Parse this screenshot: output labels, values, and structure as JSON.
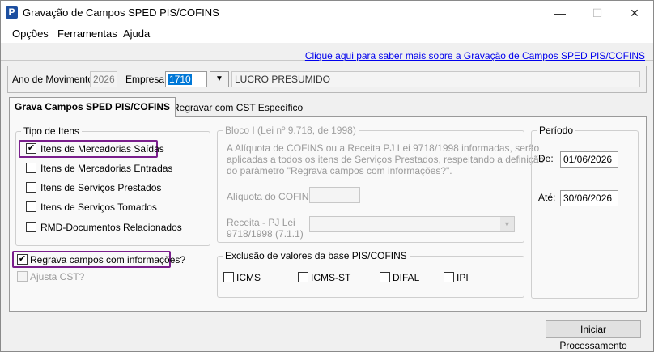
{
  "window": {
    "app_icon": "P",
    "title": "Gravação de Campos SPED PIS/COFINS",
    "minimize_glyph": "—",
    "maximize_glyph": "☐",
    "close_glyph": "✕"
  },
  "menu": {
    "items": [
      "Opções",
      "Ferramentas",
      "Ajuda"
    ]
  },
  "help_link": "Clique aqui para saber mais sobre a Gravação de Campos SPED PIS/COFINS",
  "header": {
    "ano_label": "Ano de Movimento:",
    "ano_value": "2026",
    "empresa_label": "Empresa:",
    "empresa_value": "1710",
    "empresa_dropdown_glyph": "▼",
    "regime_value": "LUCRO PRESUMIDO"
  },
  "tabs": [
    "Grava Campos SPED PIS/COFINS",
    "Regravar com CST Específico"
  ],
  "tipo_itens": {
    "legend": "Tipo de Itens",
    "items": [
      {
        "label": "Itens de Mercadorias Saídas",
        "mark": "✔"
      },
      {
        "label": "Itens de Mercadorias Entradas",
        "mark": ""
      },
      {
        "label": "Itens de Serviços Prestados",
        "mark": ""
      },
      {
        "label": "Itens de Serviços Tomados",
        "mark": ""
      },
      {
        "label": "RMD-Documentos Relacionados",
        "mark": ""
      }
    ]
  },
  "regrava": {
    "label": "Regrava campos com informações?",
    "mark": "✔"
  },
  "ajusta": {
    "label": "Ajusta CST?",
    "mark": ""
  },
  "bloco": {
    "legend": "Bloco I (Lei nº 9.718, de 1998)",
    "desc_lines": [
      "A Alíquota de COFINS ou a Receita PJ Lei 9718/1998 informadas, serão",
      "aplicadas a todos os itens de Serviços Prestados, respeitando a definição",
      "do parâmetro \"Regrava campos com informações?\"."
    ],
    "aliquota_label": "Alíquota do COFINS",
    "receita_label_line1": "Receita - PJ Lei",
    "receita_label_line2": "9718/1998 (7.1.1)",
    "receita_dropdown_glyph": "▼"
  },
  "exclusao": {
    "legend": "Exclusão de valores da base PIS/COFINS",
    "items": [
      {
        "label": "ICMS",
        "mark": ""
      },
      {
        "label": "ICMS-ST",
        "mark": ""
      },
      {
        "label": "DIFAL",
        "mark": ""
      },
      {
        "label": "IPI",
        "mark": ""
      }
    ]
  },
  "periodo": {
    "legend": "Período",
    "de_label": "De:",
    "de_value": "01/06/2026",
    "ate_label": "Até:",
    "ate_value": "30/06/2026"
  },
  "actions": {
    "start_label": "Iniciar Processamento"
  },
  "colors": {
    "highlight": "#7a1f8c",
    "link": "#0000ee",
    "selection": "#0078d7"
  }
}
